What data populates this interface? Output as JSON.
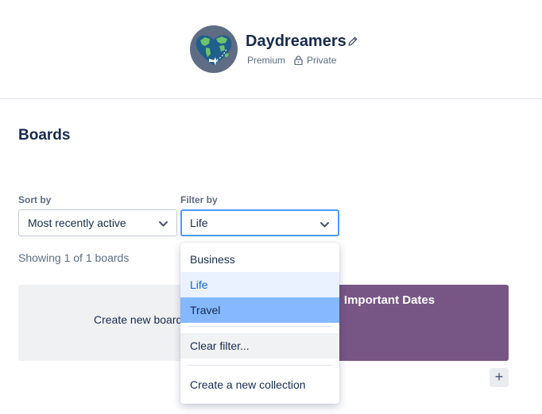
{
  "team": {
    "name": "Daydreamers",
    "plan": "Premium",
    "visibility": "Private",
    "icons": {
      "avatar": "globe-heart-icon",
      "edit": "pencil-icon",
      "lock": "lock-icon"
    }
  },
  "boards_section": {
    "title": "Boards",
    "sort": {
      "label": "Sort by",
      "value": "Most recently active"
    },
    "filter": {
      "label": "Filter by",
      "value": "Life"
    },
    "showing_text": "Showing 1 of 1 boards",
    "create_tile_label": "Create new board",
    "board": {
      "title": "Important Dates",
      "color": "#775585"
    },
    "add_button_label": "+"
  },
  "filter_dropdown": {
    "options": [
      {
        "label": "Business",
        "state": "normal"
      },
      {
        "label": "Life",
        "state": "selected"
      },
      {
        "label": "Travel",
        "state": "hovered"
      }
    ],
    "clear_label": "Clear filter...",
    "create_collection_label": "Create a new collection"
  },
  "colors": {
    "accent": "#0c66e4",
    "focus_border": "#4c9aff",
    "hover": "#85b8ff",
    "text": "#172b4d",
    "muted": "#5e6c84"
  }
}
